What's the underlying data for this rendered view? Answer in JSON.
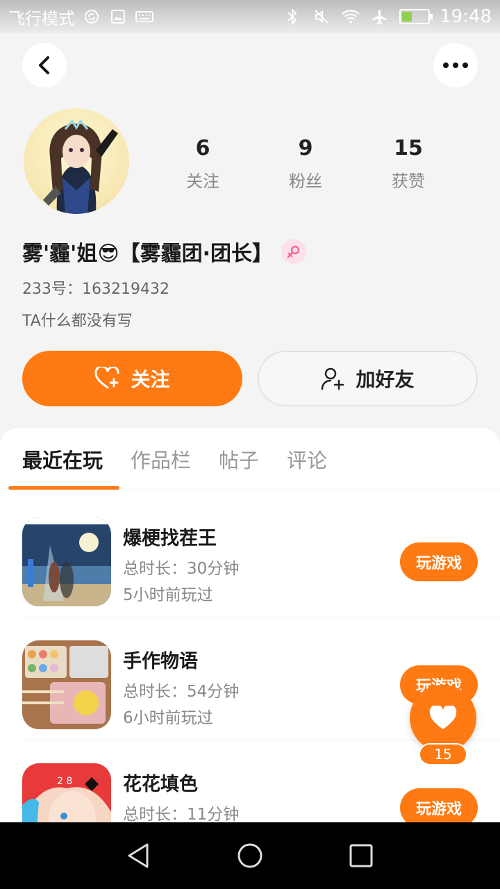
{
  "status_bar": {
    "mode_text": "飞行模式",
    "time": "19:48",
    "icons": [
      "sync-icon",
      "image-icon",
      "keyboard-icon",
      "bluetooth-icon",
      "mute-icon",
      "wifi-icon",
      "airplane-icon",
      "battery-icon"
    ]
  },
  "profile": {
    "stats": [
      {
        "value": "6",
        "label": "关注"
      },
      {
        "value": "9",
        "label": "粉丝"
      },
      {
        "value": "15",
        "label": "获赞"
      }
    ],
    "username": "雾'霾'姐😎【雾霾团·团长】",
    "user_id": "233号：163219432",
    "bio": "TA什么都没有写",
    "follow_label": "关注",
    "add_friend_label": "加好友"
  },
  "tabs": [
    "最近在玩",
    "作品栏",
    "帖子",
    "评论"
  ],
  "active_tab": 0,
  "games": [
    {
      "name": "爆梗找茬王",
      "duration": "总时长：30分钟",
      "last_played": "5小时前玩过",
      "play_label": "玩游戏"
    },
    {
      "name": "手作物语",
      "duration": "总时长：54分钟",
      "last_played": "6小时前玩过",
      "play_label": "玩游戏"
    },
    {
      "name": "花花填色",
      "duration": "总时长：11分钟",
      "last_played": "",
      "play_label": "玩游戏"
    }
  ],
  "like_fab": {
    "count": "15"
  },
  "colors": {
    "accent": "#ff7a12",
    "background": "#f4f4f4",
    "text_muted": "#888888"
  }
}
